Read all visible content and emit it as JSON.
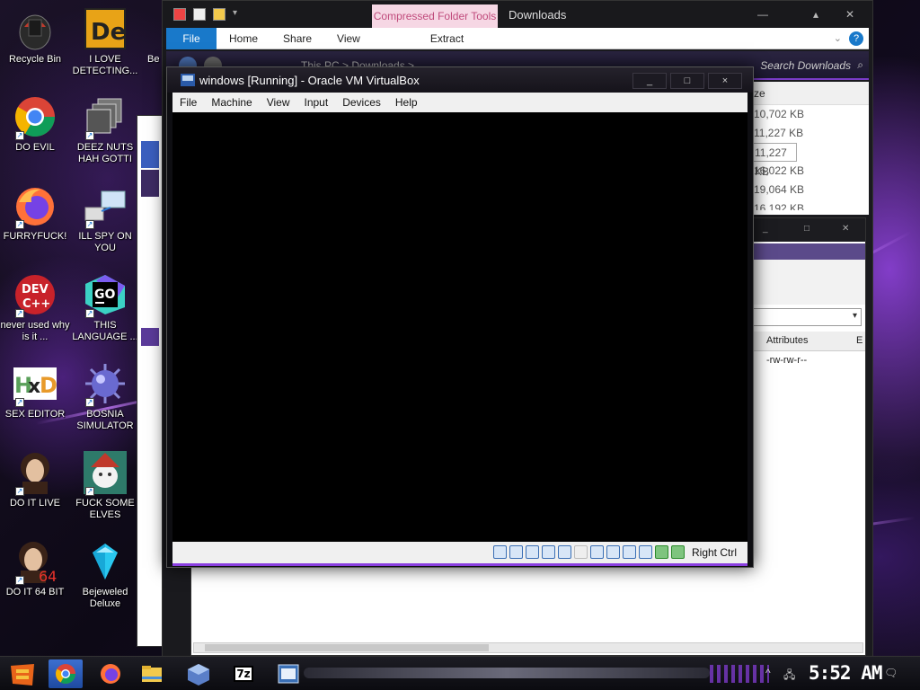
{
  "desktop": {
    "icons": [
      {
        "label": "Recycle Bin",
        "icon": "recycle-bin-icon"
      },
      {
        "label": "I LOVE DETECTING...",
        "icon": "detect-it-easy-icon"
      },
      {
        "label": "DO EVIL",
        "icon": "chrome-icon"
      },
      {
        "label": "DEEZ NUTS HAH GOTTI",
        "icon": "stack-icon"
      },
      {
        "label": "FURRYFUCK!",
        "icon": "firefox-icon"
      },
      {
        "label": "ILL SPY ON YOU",
        "icon": "network-icon"
      },
      {
        "label": "never used why is it ...",
        "icon": "devcpp-icon"
      },
      {
        "label": "THIS LANGUAGE ...",
        "icon": "goland-icon"
      },
      {
        "label": "SEX EDITOR",
        "icon": "hxd-icon"
      },
      {
        "label": "BOSNIA SIMULATOR",
        "icon": "mine-icon"
      },
      {
        "label": "DO IT LIVE",
        "icon": "portrait-icon"
      },
      {
        "label": "FUCK SOME ELVES",
        "icon": "elf-icon"
      },
      {
        "label": "DO IT 64 BIT",
        "icon": "portrait-64-icon"
      },
      {
        "label": "Bejeweled Deluxe",
        "icon": "gem-icon"
      }
    ],
    "partial_label": "Be"
  },
  "explorer": {
    "context_tab": "Compressed Folder Tools",
    "title": "Downloads",
    "ribbon_tabs": [
      "File",
      "Home",
      "Share",
      "View",
      "Extract"
    ],
    "address_path": "This PC  >  Downloads  >",
    "search_placeholder": "Search Downloads",
    "size_header": "ze",
    "sizes": [
      "10,702 KB",
      "11,227 KB",
      "11,227 KB",
      "16,022 KB",
      "19,064 KB",
      "16,192 KB"
    ]
  },
  "props": {
    "col_attributes": "Attributes",
    "col_extra": "E",
    "attr_value": "-rw-rw-r--"
  },
  "vbox": {
    "title": "windows  [Running] - Oracle VM VirtualBox",
    "menu": [
      "File",
      "Machine",
      "View",
      "Input",
      "Devices",
      "Help"
    ],
    "host_key": "Right Ctrl",
    "controls": {
      "minimize": "_",
      "maximize": "□",
      "close": "×"
    }
  },
  "taskbar": {
    "clock": "5:52 AM",
    "app_7z_label": "7z"
  },
  "colors": {
    "accent_purple": "#8a3fe0",
    "ribbon_file_blue": "#1979ca",
    "context_pink": "#f6d7e4"
  }
}
